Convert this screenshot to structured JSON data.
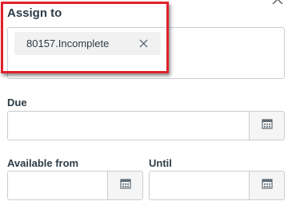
{
  "assign": {
    "label": "Assign to",
    "tokens": [
      {
        "text": "80157.Incomplete",
        "remove_icon": "close-icon"
      }
    ]
  },
  "due": {
    "label": "Due",
    "value": "",
    "button_icon": "calendar-icon"
  },
  "available_from": {
    "label": "Available from",
    "value": "",
    "button_icon": "calendar-icon"
  },
  "until": {
    "label": "Until",
    "value": "",
    "button_icon": "calendar-icon"
  },
  "colors": {
    "highlight": "#e0232c",
    "text": "#2d3b45",
    "border": "#c7cdd1",
    "token_bg": "#f1f1f1"
  }
}
